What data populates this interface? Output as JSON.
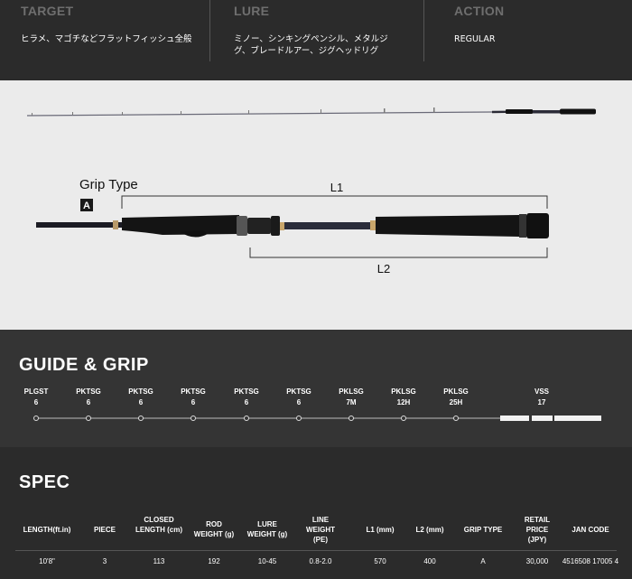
{
  "top": {
    "target": {
      "heading": "TARGET",
      "text": "ヒラメ、マゴチなどフラットフィッシュ全般"
    },
    "lure": {
      "heading": "LURE",
      "text": "ミノー、シンキングペンシル、メタルジグ、ブレードルアー、ジグヘッドリグ"
    },
    "action": {
      "heading": "ACTION",
      "text": "REGULAR"
    }
  },
  "image": {
    "grip_type_label": "Grip Type",
    "grip_type_badge": "A",
    "l1_label": "L1",
    "l2_label": "L2"
  },
  "guide": {
    "title": "GUIDE & GRIP",
    "items": [
      {
        "type": "PLGST",
        "size": "6"
      },
      {
        "type": "PKTSG",
        "size": "6"
      },
      {
        "type": "PKTSG",
        "size": "6"
      },
      {
        "type": "PKTSG",
        "size": "6"
      },
      {
        "type": "PKTSG",
        "size": "6"
      },
      {
        "type": "PKTSG",
        "size": "6"
      },
      {
        "type": "PKLSG",
        "size": "7M"
      },
      {
        "type": "PKLSG",
        "size": "12H"
      },
      {
        "type": "PKLSG",
        "size": "25H"
      },
      {
        "type": "VSS",
        "size": "17"
      }
    ]
  },
  "spec": {
    "title": "SPEC",
    "headers": [
      "LENGTH(ft.in)",
      "PIECE",
      "CLOSED LENGTH (cm)",
      "ROD WEIGHT (g)",
      "LURE WEIGHT (g)",
      "LINE WEIGHT (PE)",
      "L1 (mm)",
      "L2 (mm)",
      "GRIP TYPE",
      "RETAIL PRICE (JPY)",
      "JAN CODE"
    ],
    "values": [
      "10'8\"",
      "3",
      "113",
      "192",
      "10-45",
      "0.8-2.0",
      "570",
      "400",
      "A",
      "30,000",
      "4516508 17005 4"
    ]
  }
}
